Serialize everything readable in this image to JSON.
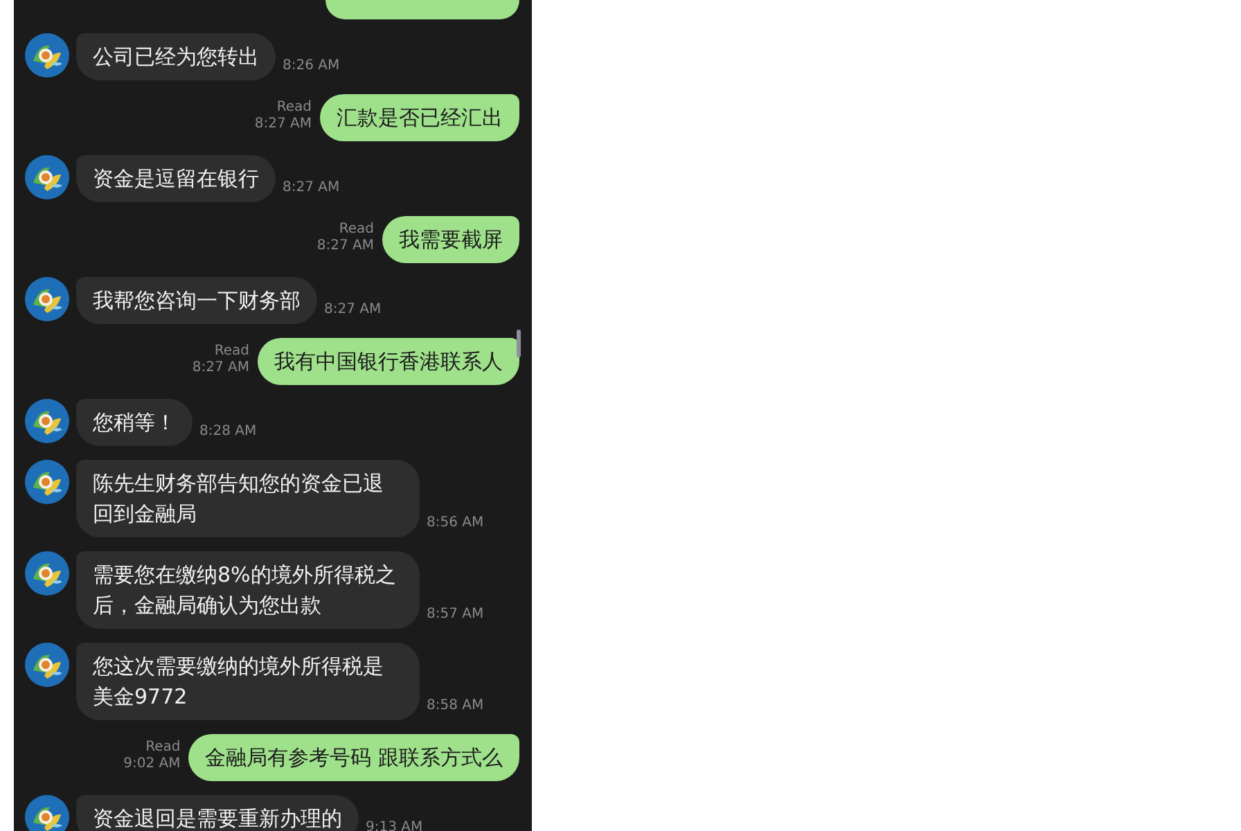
{
  "messages": [
    {
      "kind": "clipped"
    },
    {
      "kind": "incoming",
      "text": "公司已经为您转出",
      "time": "8:26 AM"
    },
    {
      "kind": "outgoing",
      "text": "汇款是否已经汇出",
      "read": "Read",
      "time": "8:27 AM"
    },
    {
      "kind": "incoming",
      "text": "资金是逗留在银行",
      "time": "8:27 AM"
    },
    {
      "kind": "outgoing",
      "text": "我需要截屏",
      "read": "Read",
      "time": "8:27 AM"
    },
    {
      "kind": "incoming",
      "text": "我帮您咨询一下财务部",
      "time": "8:27 AM"
    },
    {
      "kind": "outgoing",
      "text": "我有中国银行香港联系人",
      "read": "Read",
      "time": "8:27 AM"
    },
    {
      "kind": "incoming",
      "text": "您稍等！",
      "time": "8:28 AM"
    },
    {
      "kind": "incoming",
      "text": "陈先生财务部告知您的资金已退回到金融局",
      "time": "8:56 AM"
    },
    {
      "kind": "incoming",
      "text": "需要您在缴纳8%的境外所得税之后，金融局确认为您出款",
      "time": "8:57 AM"
    },
    {
      "kind": "incoming",
      "text": "您这次需要缴纳的境外所得税是美金9772",
      "time": "8:58 AM"
    },
    {
      "kind": "outgoing",
      "text": "金融局有参考号码 跟联系方式么",
      "read": "Read",
      "time": "9:02 AM"
    },
    {
      "kind": "incoming",
      "text": "资金退回是需要重新办理的",
      "time": "9:13 AM"
    }
  ]
}
